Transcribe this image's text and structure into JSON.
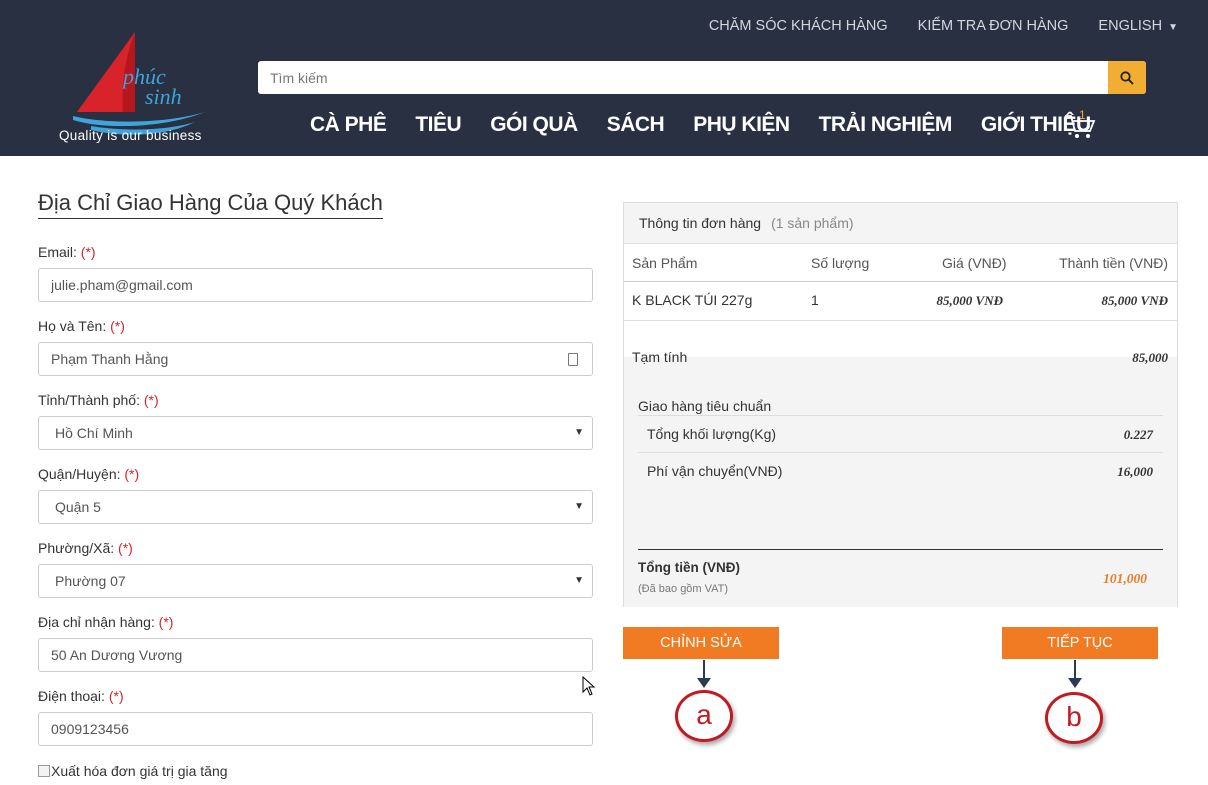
{
  "header": {
    "logo_text": "phúc sinh",
    "tagline": "Quality is our business",
    "top_links": [
      "CHĂM SÓC KHÁCH HÀNG",
      "KIỂM TRA ĐƠN HÀNG",
      "ENGLISH"
    ],
    "search_placeholder": "Tìm kiếm",
    "nav": [
      "CÀ PHÊ",
      "TIÊU",
      "GÓI QUÀ",
      "SÁCH",
      "PHỤ KIỆN",
      "TRẢI NGHIỆM",
      "GIỚI THIỆU"
    ],
    "cart_count": "1",
    "colors": {
      "header_bg": "#283041",
      "accent": "#f2ae32"
    }
  },
  "form": {
    "title": "Địa Chỉ Giao Hàng Của Quý Khách",
    "required_mark": "(*)",
    "email_label": "Email:",
    "email_value": "julie.pham@gmail.com",
    "name_label": "Họ và Tên:",
    "name_value": "Phạm Thanh Hằng",
    "city_label": "Tỉnh/Thành phố:",
    "city_value": "Hồ Chí Minh",
    "district_label": "Quận/Huyện:",
    "district_value": "Quận 5",
    "ward_label": "Phường/Xã:",
    "ward_value": "Phường 07",
    "address_label": "Địa chỉ nhận hàng:",
    "address_value": "50 An Dương Vương",
    "phone_label": "Điện thoại:",
    "phone_value": "0909123456",
    "vat_checkbox_label": "Xuất hóa đơn giá trị gia tăng"
  },
  "order": {
    "title": "Thông tin đơn hàng",
    "count": "(1 sản phẩm)",
    "columns": [
      "Sản Phẩm",
      "Số lượng",
      "Giá (VNĐ)",
      "Thành tiền (VNĐ)"
    ],
    "items": [
      {
        "name": "K BLACK TÚI 227g",
        "qty": "1",
        "price": "85,000 VNĐ",
        "total": "85,000 VNĐ"
      }
    ],
    "subtotal_label": "Tạm tính",
    "subtotal_value": "85,000",
    "shipping_title": "Giao hàng tiêu chuẩn",
    "weight_label": "Tổng khối lượng(Kg)",
    "weight_value": "0.227",
    "fee_label": "Phí vận chuyển(VNĐ)",
    "fee_value": "16,000",
    "grand_label": "Tổng tiền (VNĐ)",
    "grand_note": "(Đã bao gồm VAT)",
    "grand_value": "101,000",
    "grand_color": "#f07b22"
  },
  "buttons": {
    "edit_label": "CHỈNH SỬA",
    "continue_label": "TIẾP TỤC",
    "color": "#f07b22"
  },
  "annotations": {
    "a": "a",
    "b": "b"
  }
}
